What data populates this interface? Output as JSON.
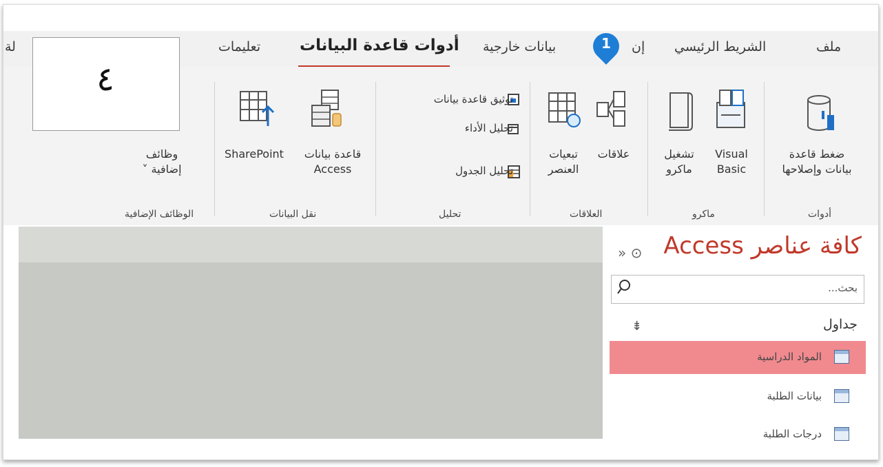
{
  "tabs": {
    "file": "ملف",
    "home": "الشريط الرئيسي",
    "create": "إن",
    "external_data": "بيانات خارجية",
    "database_tools": "أدوات قاعدة البيانات",
    "help": "تعليمات",
    "partial_left": "لة"
  },
  "callout": {
    "number": "1",
    "box_text": "٤",
    "color": "#1e7ed6"
  },
  "ribbon": {
    "groups": {
      "tools": {
        "label": "أدوات",
        "compact_repair_line1": "ضغط قاعدة",
        "compact_repair_line2": "بيانات وإصلاحها"
      },
      "macro": {
        "label": "ماكرو",
        "visual_basic_line1": "Visual",
        "visual_basic_line2": "Basic",
        "run_macro_line1": "تشغيل",
        "run_macro_line2": "ماكرو"
      },
      "relationships": {
        "label": "العلاقات",
        "relationships": "علاقات",
        "object_dependencies_line1": "تبعيات",
        "object_dependencies_line2": "العنصر"
      },
      "analyze": {
        "label": "تحليل",
        "database_documenter": "توثيق قاعدة بيانات",
        "analyze_performance": "تحليل الأداء",
        "analyze_table": "تحليل الجدول"
      },
      "move_data": {
        "label": "نقل البيانات",
        "access_db_line1": "قاعدة بيانات",
        "access_db_line2": "Access",
        "sharepoint": "SharePoint"
      },
      "addins": {
        "label": "الوظائف الإضافية",
        "addins_line1": "وظائف",
        "addins_line2": "إضافية ˅"
      }
    }
  },
  "nav": {
    "title": "كافة عناصر Access",
    "controls": "» ⊙",
    "search_placeholder": "بحث...",
    "section": "جداول",
    "section_icon": "chevron-up-double-icon",
    "items": [
      {
        "label": "المواد الدراسية",
        "selected": true
      },
      {
        "label": "بيانات الطلبة",
        "selected": false
      },
      {
        "label": "درجات الطلبة",
        "selected": false
      }
    ],
    "selected_color": "#f08a8f"
  },
  "colors": {
    "accent": "#c0392b"
  }
}
